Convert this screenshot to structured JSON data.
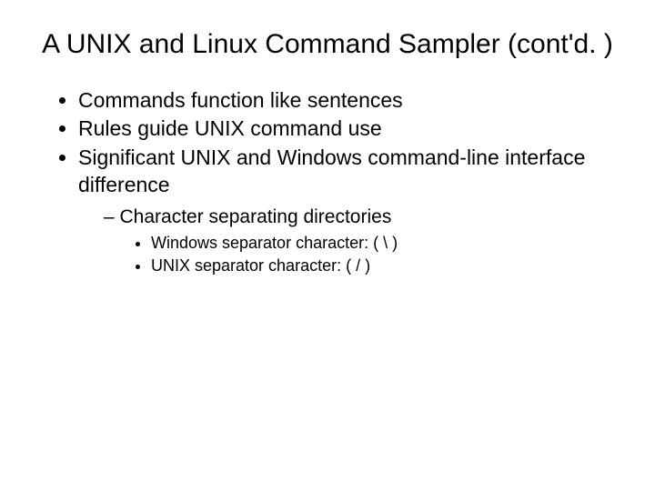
{
  "title": "A UNIX and Linux Command Sampler (cont'd. )",
  "bullets": {
    "b1": "Commands function like sentences",
    "b2": "Rules guide UNIX command use",
    "b3": "Significant UNIX and Windows command-line interface difference",
    "sub1": "Character separating directories",
    "subsub1": "Windows separator character: ( \\ )",
    "subsub2": "UNIX separator character: ( / )"
  }
}
